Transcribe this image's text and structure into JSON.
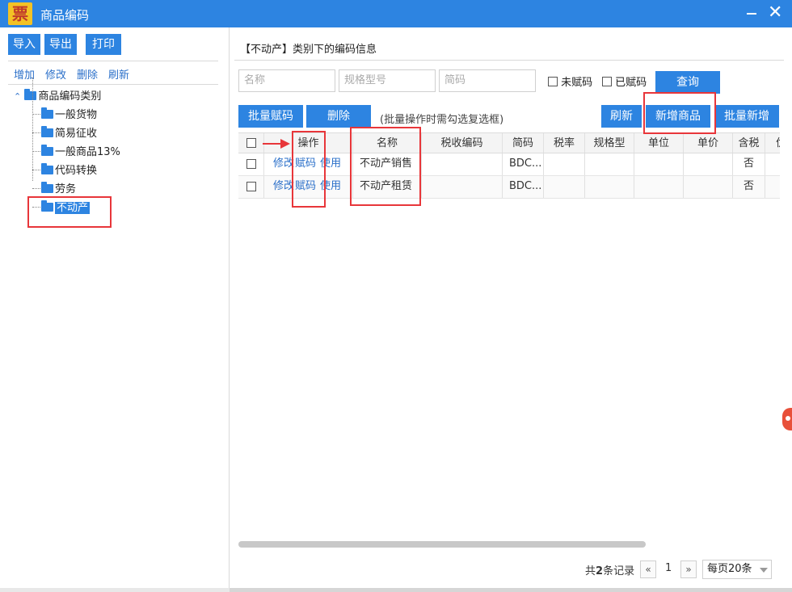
{
  "window": {
    "logo_char": "票",
    "title": "商品编码",
    "minimize": "—",
    "close": "✕"
  },
  "left": {
    "toolbar": {
      "import": "导入",
      "export": "导出",
      "print": "打印"
    },
    "links": {
      "add": "增加",
      "edit": "修改",
      "delete": "删除",
      "refresh": "刷新"
    },
    "tree": {
      "root": "商品编码类别",
      "collapse_icon": "⌃",
      "items": [
        {
          "label": "一般货物"
        },
        {
          "label": "简易征收"
        },
        {
          "label": "一般商品13%"
        },
        {
          "label": "代码转换"
        },
        {
          "label": "劳务"
        },
        {
          "label": "不动产"
        }
      ]
    }
  },
  "right": {
    "title": "【不动产】类别下的编码信息",
    "search": {
      "name_placeholder": "名称",
      "spec_placeholder": "规格型号",
      "code_placeholder": "简码",
      "not_coded": "未赋码",
      "coded": "已赋码",
      "query": "查询"
    },
    "actions": {
      "batch_assign": "批量赋码",
      "delete": "删除",
      "hint": "(批量操作时需勾选复选框)",
      "refresh": "刷新",
      "add_product": "新增商品",
      "batch_add": "批量新增"
    },
    "table": {
      "columns": [
        "操作",
        "名称",
        "税收编码",
        "简码",
        "税率",
        "规格型",
        "单位",
        "单价",
        "含税",
        "优"
      ],
      "rows": [
        {
          "ops": [
            "修改",
            "赋码",
            "使用"
          ],
          "name": "不动产销售",
          "tax_code": "",
          "short_code": "BDC...",
          "rate": "",
          "spec": "",
          "unit": "",
          "price": "",
          "tax_incl": "否"
        },
        {
          "ops": [
            "修改",
            "赋码",
            "使用"
          ],
          "name": "不动产租赁",
          "tax_code": "",
          "short_code": "BDC...",
          "rate": "",
          "spec": "",
          "unit": "",
          "price": "",
          "tax_incl": "否"
        }
      ]
    },
    "pager": {
      "total_prefix": "共",
      "total_count": "2",
      "total_suffix": "条记录",
      "prev": "«",
      "page": "1",
      "next": "»",
      "per_page": "每页20条"
    }
  },
  "colors": {
    "accent": "#2d84e1",
    "annotation": "#e8363a"
  }
}
